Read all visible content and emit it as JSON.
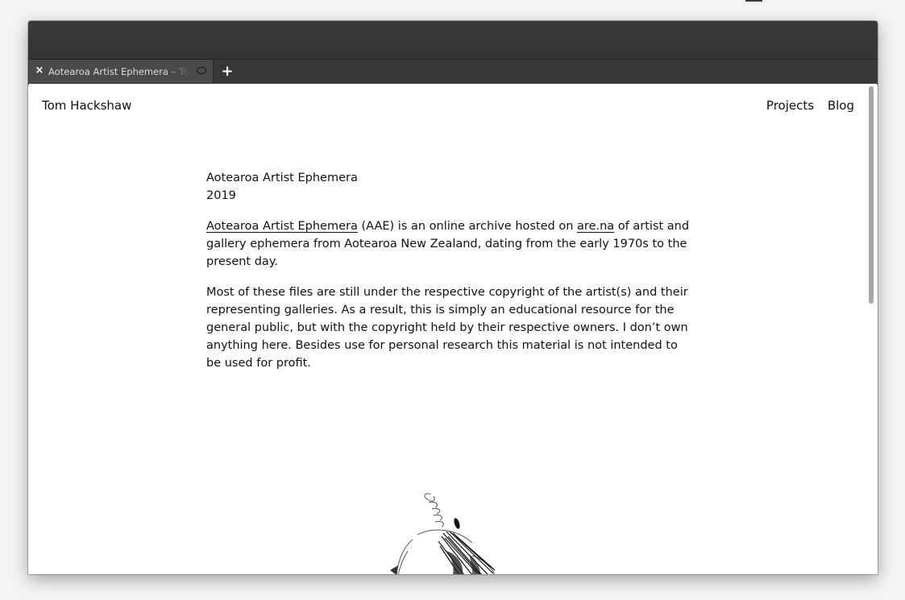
{
  "browser": {
    "tab_title": "Aotearoa Artist Ephemera – Tom Hackshaw",
    "tab_close_icon": "×",
    "new_tab_icon": "+"
  },
  "site": {
    "name": "Tom Hackshaw",
    "nav": [
      "Projects",
      "Blog"
    ]
  },
  "project": {
    "title": "Aotearoa Artist Ephemera",
    "year": "2019",
    "intro": {
      "link_text": "Aotearoa Artist Ephemera",
      "text_a": " (AAE) is an online archive hosted on ",
      "link2_text": "are.na",
      "text_b": " of artist and gallery ephemera from Aotearoa New Zealand, dating from the early 1970s to the present day."
    },
    "paragraph2": "Most of these files are still under the respective copyright of the artist(s) and their representing galleries. As a result, this is simply an educational resource for the general public, but with the copyright held by their respective owners. I don’t own anything here. Besides use for personal research this material is not intended to be used for profit."
  }
}
